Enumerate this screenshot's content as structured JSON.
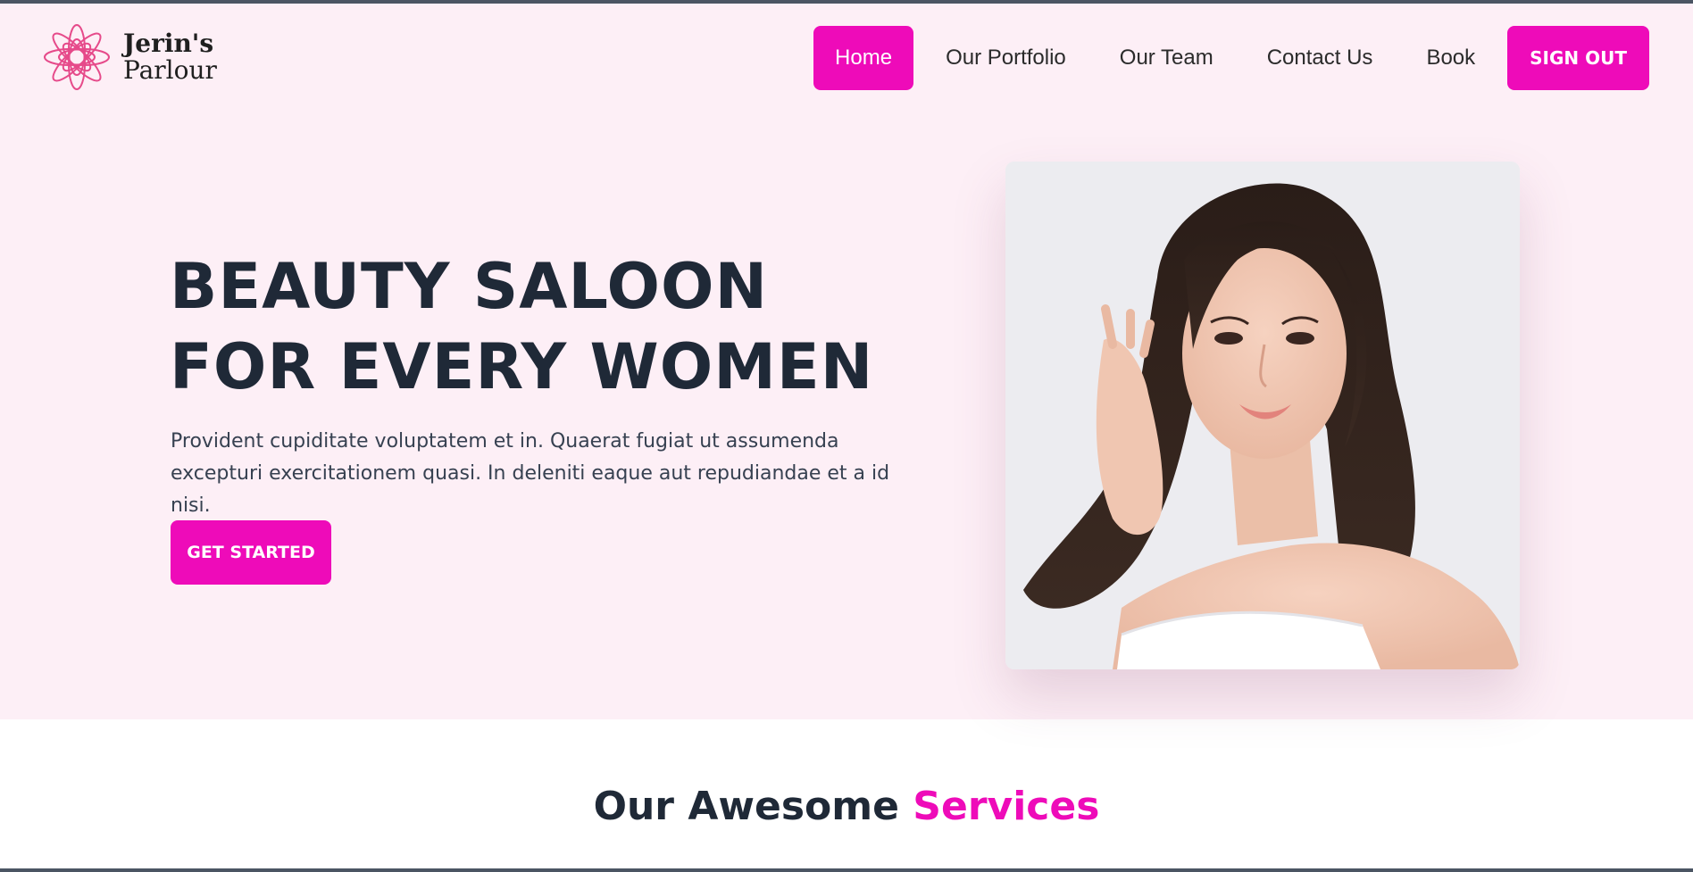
{
  "brand": {
    "line1": "Jerin's",
    "line2": "Parlour",
    "icon": "lotus-flower-icon"
  },
  "nav": {
    "items": [
      {
        "label": "Home",
        "active": true
      },
      {
        "label": "Our Portfolio",
        "active": false
      },
      {
        "label": "Our Team",
        "active": false
      },
      {
        "label": "Contact Us",
        "active": false
      },
      {
        "label": "Book",
        "active": false
      }
    ],
    "signout_label": "SIGN OUT"
  },
  "hero": {
    "title_line1": "BEAUTY SALOON",
    "title_line2": "FOR EVERY WOMEN",
    "description": "Provident cupiditate voluptatem et in. Quaerat fugiat ut assumenda excepturi exercitationem quasi. In deleniti eaque aut repudiandae et a id nisi.",
    "cta_label": "GET STARTED"
  },
  "services": {
    "title_prefix": "Our Awesome ",
    "title_accent": "Services"
  },
  "colors": {
    "accent": "#ee0bb9",
    "hero_background": "#fdeff6",
    "heading": "#1f2937"
  }
}
